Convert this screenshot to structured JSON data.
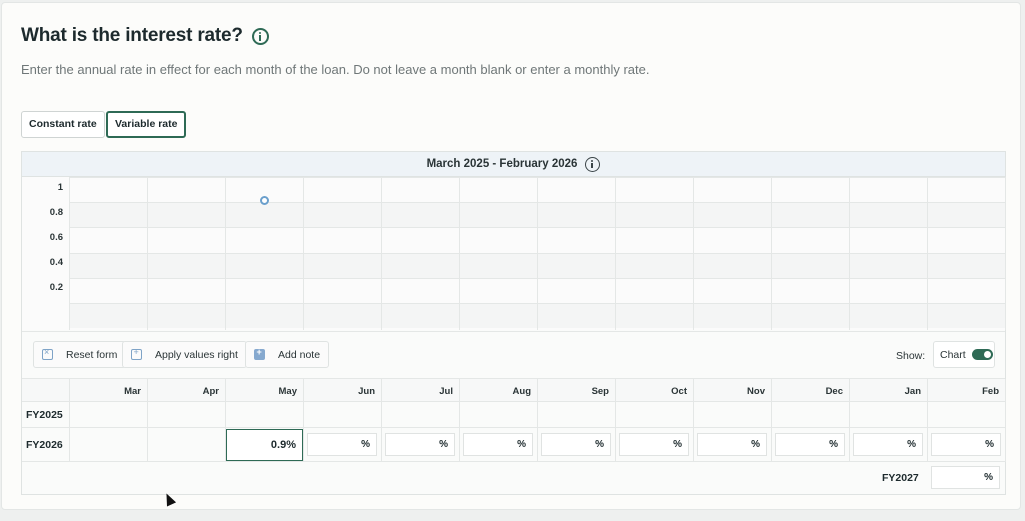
{
  "title": "What is the interest rate?",
  "description": "Enter the annual rate in effect for each month of the loan. Do not leave a month blank or enter a monthly rate.",
  "rate_modes": [
    "Constant rate",
    "Variable rate"
  ],
  "selected_mode": "Variable rate",
  "chart": {
    "header": "March 2025 - February 2026"
  },
  "chart_data": {
    "type": "scatter",
    "title": "March 2025 - February 2026",
    "categories": [
      "Mar",
      "Apr",
      "May",
      "Jun",
      "Jul",
      "Aug",
      "Sep",
      "Oct",
      "Nov",
      "Dec",
      "Jan",
      "Feb"
    ],
    "y_ticks": [
      "1",
      "0.8",
      "0.6",
      "0.4",
      "0.2"
    ],
    "ylim": [
      0,
      1.1
    ],
    "points": [
      {
        "x": "May",
        "y": 0.9
      }
    ],
    "grid": true,
    "point_color": "#6a9fcc"
  },
  "toolbar": {
    "reset": "Reset form",
    "apply": "Apply values right",
    "note": "Add note",
    "show_label": "Show:",
    "chart_toggle": "Chart"
  },
  "table": {
    "months": [
      "Mar",
      "Apr",
      "May",
      "Jun",
      "Jul",
      "Aug",
      "Sep",
      "Oct",
      "Nov",
      "Dec",
      "Jan",
      "Feb"
    ],
    "row_fy2025": "FY2025",
    "row_fy2026": "FY2026",
    "row_fy2027": "FY2027",
    "fy2026_values": [
      "",
      "",
      "0.9%",
      "%",
      "%",
      "%",
      "%",
      "%",
      "%",
      "%",
      "%",
      "%"
    ],
    "fy2027_value": "%"
  },
  "colors": {
    "accent": "#2e6a55",
    "chart_header_bg": "#eef3f7"
  }
}
